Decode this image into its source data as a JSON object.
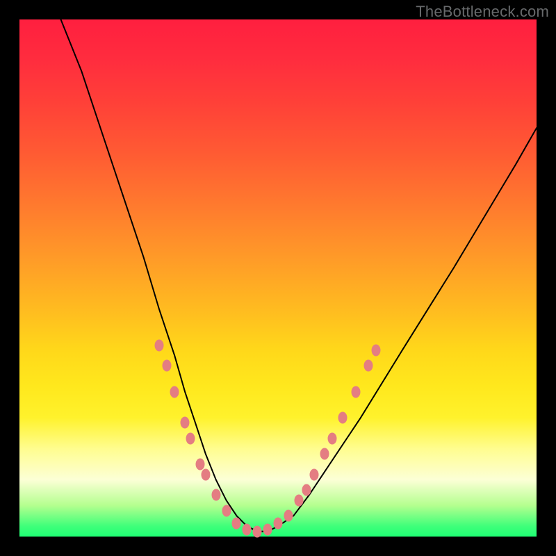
{
  "watermark": "TheBottleneck.com",
  "colors": {
    "background": "#000000",
    "curve": "#000000",
    "marker": "#e47d82"
  },
  "chart_data": {
    "type": "line",
    "title": "",
    "xlabel": "",
    "ylabel": "",
    "xlim": [
      0,
      100
    ],
    "ylim": [
      0,
      100
    ],
    "grid": false,
    "legend": false,
    "series": [
      {
        "name": "bottleneck-curve",
        "x": [
          8,
          12,
          16,
          20,
          24,
          27,
          30,
          32,
          34,
          36,
          38,
          40,
          42,
          44,
          46,
          48,
          50,
          53,
          56,
          60,
          66,
          74,
          84,
          96,
          100
        ],
        "y": [
          100,
          90,
          78,
          66,
          54,
          44,
          35,
          28,
          22,
          16,
          11,
          7,
          4,
          2,
          1,
          1,
          2,
          4,
          8,
          14,
          23,
          36,
          52,
          72,
          79
        ]
      }
    ],
    "markers": {
      "name": "curve-dots",
      "description": "Salmon elliptical markers along lower part of curve",
      "points": [
        {
          "x": 27,
          "y": 37
        },
        {
          "x": 28.5,
          "y": 33
        },
        {
          "x": 30,
          "y": 28
        },
        {
          "x": 32,
          "y": 22
        },
        {
          "x": 33,
          "y": 19
        },
        {
          "x": 35,
          "y": 14
        },
        {
          "x": 36,
          "y": 12
        },
        {
          "x": 38,
          "y": 8
        },
        {
          "x": 40,
          "y": 5
        },
        {
          "x": 42,
          "y": 2.5
        },
        {
          "x": 44,
          "y": 1.3
        },
        {
          "x": 46,
          "y": 1
        },
        {
          "x": 48,
          "y": 1.3
        },
        {
          "x": 50,
          "y": 2.5
        },
        {
          "x": 52,
          "y": 4
        },
        {
          "x": 54,
          "y": 7
        },
        {
          "x": 55.5,
          "y": 9
        },
        {
          "x": 57,
          "y": 12
        },
        {
          "x": 59,
          "y": 16
        },
        {
          "x": 60.5,
          "y": 19
        },
        {
          "x": 62.5,
          "y": 23
        },
        {
          "x": 65,
          "y": 28
        },
        {
          "x": 67.5,
          "y": 33
        },
        {
          "x": 69,
          "y": 36
        }
      ]
    }
  }
}
